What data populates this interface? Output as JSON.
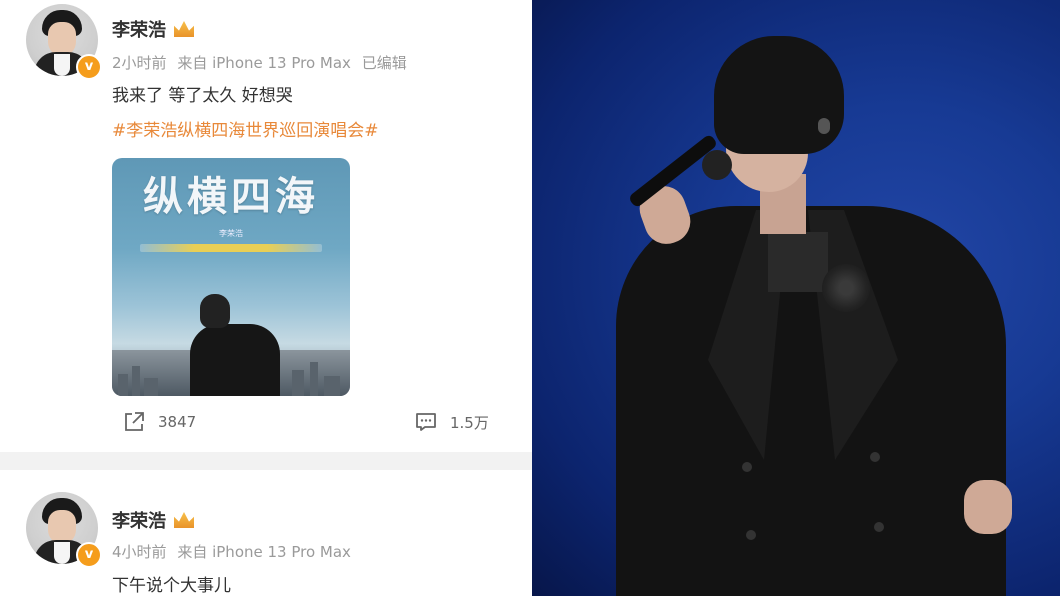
{
  "posts": [
    {
      "username": "李荣浩",
      "time": "2小时前",
      "source": "来自 iPhone 13 Pro Max",
      "edited": "已编辑",
      "text": "我来了 等了太久 好想哭",
      "hashtag": "#李荣浩纵横四海世界巡回演唱会#",
      "poster": {
        "title": "纵横四海",
        "subtitle": "李荣浩"
      },
      "reposts": "3847",
      "comments": "1.5万"
    },
    {
      "username": "李荣浩",
      "time": "4小时前",
      "source": "来自 iPhone 13 Pro Max",
      "text": "下午说个大事儿"
    }
  ],
  "colors": {
    "hashtag": "#e8893a",
    "verified_badge": "#f59d1c",
    "meta_text": "#9a9a9a",
    "stage_blue": "#173a94"
  },
  "icons": {
    "verified": "v-badge-icon",
    "member": "crown-icon",
    "repost": "share-icon",
    "comment": "comment-icon"
  }
}
